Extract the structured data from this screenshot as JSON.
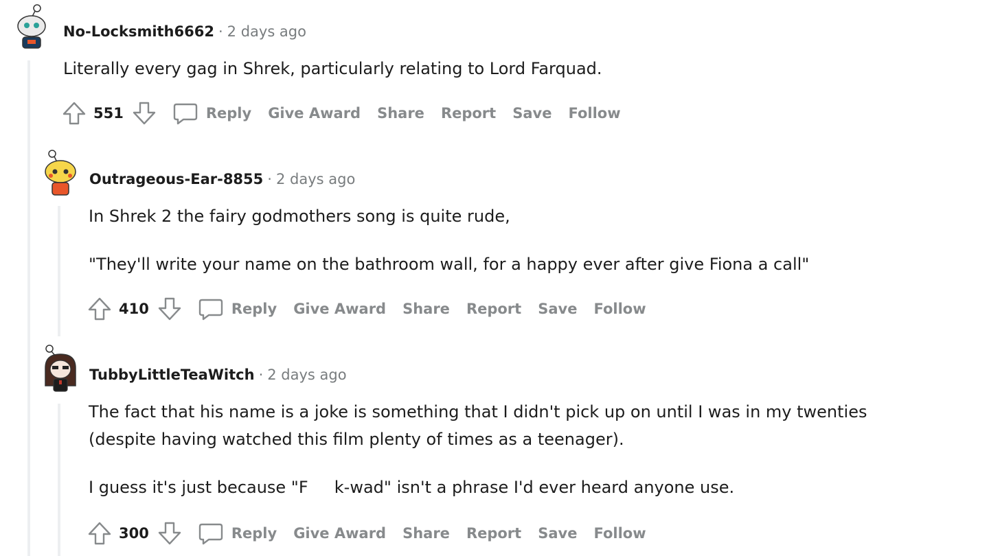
{
  "colors": {
    "text": "#1c1c1c",
    "meta": "#787c7e",
    "action": "#878a8c",
    "thread_line": "#edeff1"
  },
  "comments": [
    {
      "username": "No-Locksmith6662",
      "separator": "·",
      "time": "2 days ago",
      "paragraphs": [
        "Literally every gag in Shrek, particularly relating to Lord Farquad."
      ],
      "score": "551",
      "actions": {
        "reply": "Reply",
        "award": "Give Award",
        "share": "Share",
        "report": "Report",
        "save": "Save",
        "follow": "Follow"
      }
    },
    {
      "username": "Outrageous-Ear-8855",
      "separator": "·",
      "time": "2 days ago",
      "paragraphs": [
        "In Shrek 2 the fairy godmothers song is quite rude,",
        "\"They'll write your name on the bathroom wall, for a happy ever after give Fiona a call\""
      ],
      "score": "410",
      "actions": {
        "reply": "Reply",
        "award": "Give Award",
        "share": "Share",
        "report": "Report",
        "save": "Save",
        "follow": "Follow"
      }
    },
    {
      "username": "TubbyLittleTeaWitch",
      "separator": "·",
      "time": "2 days ago",
      "paragraphs": [
        "The fact that his name is a joke is something that I didn't pick up on until I was in my twenties",
        "(despite having watched this film plenty of times as a teenager).",
        "I guess it's just because \"F     k-wad\" isn't a phrase I'd ever heard anyone use."
      ],
      "score": "300",
      "actions": {
        "reply": "Reply",
        "award": "Give Award",
        "share": "Share",
        "report": "Report",
        "save": "Save",
        "follow": "Follow"
      }
    }
  ]
}
